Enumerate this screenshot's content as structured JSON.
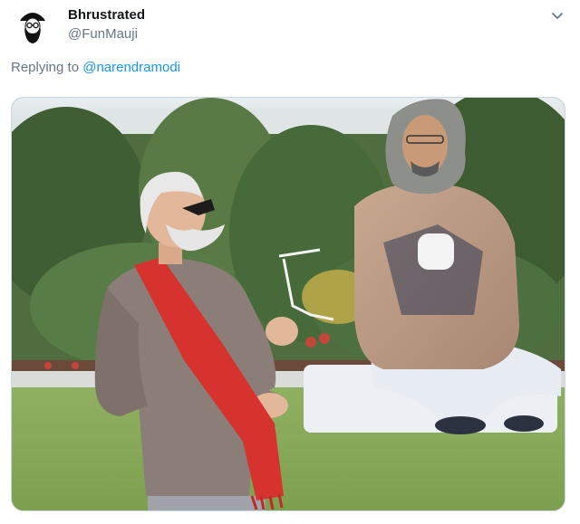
{
  "tweet": {
    "author": {
      "display_name": "Bhrustrated",
      "handle": "@FunMauji",
      "avatar_icon": "bearded-man-avatar-icon"
    },
    "reply": {
      "prefix": "Replying to",
      "mention": "@narendramodi"
    },
    "menu_icon": "chevron-down-icon",
    "colors": {
      "link": "#1b95e0",
      "secondary_text": "#657786",
      "primary_text": "#14171a"
    }
  }
}
